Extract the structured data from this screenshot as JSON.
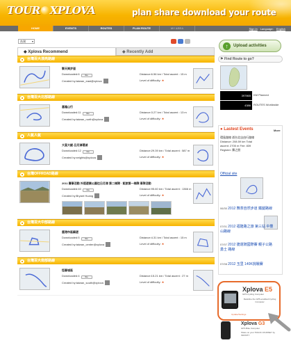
{
  "header": {
    "logo_left": "TOUR",
    "logo_right": "XPLOVA",
    "tagline": "plan  share  download  your route"
  },
  "nav": {
    "items": [
      "HOME",
      "EVENTS",
      "ROUTES",
      "PLAN ROUTE",
      "MY AREA"
    ],
    "active_index": 0
  },
  "top_links": [
    "Sign in",
    "Language:",
    "English"
  ],
  "controls": {
    "language_select": "台灣"
  },
  "upload_button": "Upload activities",
  "tabs": {
    "recommend": "Xplova Recommend",
    "recent": "Recently Add"
  },
  "routes": [
    {
      "category": "台灣百大漂亮路線",
      "title": "擎天崗步道",
      "downloaded": "Downloaded:6",
      "created_by": "Created by:taiwan_east@xplova",
      "distance": "Distance:6.56 km / Total ascent : 15 m",
      "level": "Level of difficulty:"
    },
    {
      "category": "台灣百大北部路線",
      "title": "基隆山行",
      "downloaded": "Downloaded:11",
      "created_by": "Created by:taiwan_north@xplova",
      "distance": "Distance:3.27 km / Total ascent : 13 m",
      "level": "Level of difficulty:"
    },
    {
      "category": "人氣人氣",
      "title": "大直大縱-日月潭環湖",
      "downloaded": "Downloaded:12",
      "created_by": "Created by:xeights@xplova",
      "distance": "Distance:29.39 km / Total ascent : 587 m",
      "level": "Level of difficulty:"
    },
    {
      "category": "台灣OFFROAD路線",
      "title": "2011 賽事活動 外提遊樂公園往日月潭 第二梯隊 · 鉅旅第一梯隊 車隊活動",
      "downloaded": "Downloaded:40",
      "created_by": "Created by:Bryant Huang",
      "distance": "Distance:95.60 km / Total ascent : 1366 m",
      "level": "Level of difficulty:"
    },
    {
      "category": "台灣百大中部路線",
      "title": "鹿港市區騎遊",
      "downloaded": "Downloaded:5",
      "created_by": "Created by:taiwan_center@xplova",
      "distance": "Distance:4.31 km / Total ascent : 15 m",
      "level": "Level of difficulty:"
    },
    {
      "category": "台灣百大南部路線",
      "title": "恆春城區",
      "downloaded": "Downloaded:4",
      "created_by": "Created by:taiwan_south@xplova",
      "distance": "Distance:15.21 km / Total ascent : 27 m",
      "level": "Level of difficulty:"
    }
  ],
  "sidebar": {
    "find_route": "Find Route to go?",
    "stats": [
      {
        "value": "397865",
        "label": "KM Planned"
      },
      {
        "value": "4386",
        "label": "ROUTES Worldwide"
      }
    ],
    "latest_title": "Lastest Events",
    "latest_more": "More",
    "latest_text": "環島路線 遊台北自由行路線 Distance: 208.59 km Total ascent: 2705 m Fee: 839 Register: 陳之朋",
    "event_link": "Official site",
    "events": [
      {
        "date": "06/30",
        "name": "2012 舞茶自然步道 鐵腿路線"
      },
      {
        "date": "07/01",
        "name": "2012 福隆路之旅 第三站 中豐山路線"
      },
      {
        "date": "07/07",
        "name": "2012 捷運騎國際賽 親子公路勇士 路線"
      },
      {
        "date": "07/08",
        "name": "2012 玉里 140K挑戰賽"
      }
    ]
  },
  "ad": {
    "brand": "Xplova",
    "model": "E5",
    "subtitle": "GPS Cycling Computer",
    "desc": "Redefine the GPS-enabled Cycling Computer",
    "update": "Update/Settings",
    "brand2": "Xplova",
    "model2": "G3",
    "subtitle2": "GPS Bike Computer",
    "desc2": "Share on your TRACK JOURNEY by INFINITY"
  },
  "colors": {
    "brand_orange": "#f7a600",
    "category_yellow": "#ffcc00",
    "accent_red": "#e0401a",
    "ad_border": "#e76a2a"
  }
}
